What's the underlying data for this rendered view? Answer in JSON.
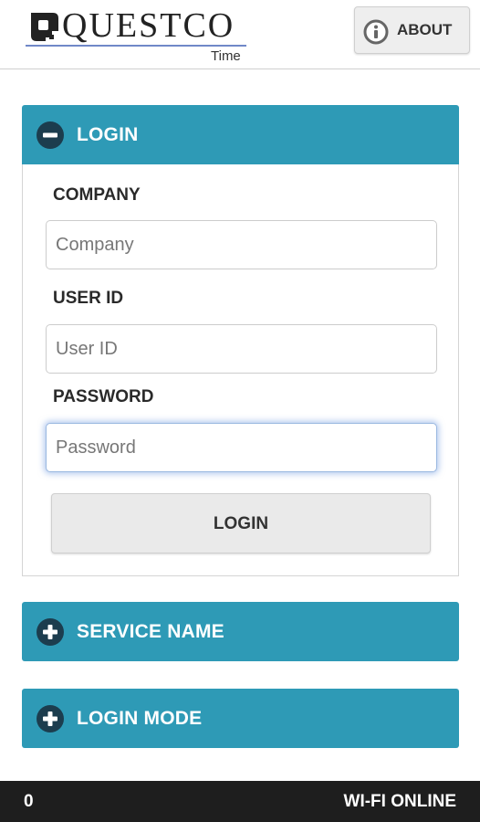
{
  "header": {
    "logo_text": "QUESTCO",
    "logo_subtitle": "Time",
    "about_label": "ABOUT",
    "about_icon": "info-icon"
  },
  "login_panel": {
    "title": "LOGIN",
    "icon": "minus-circle-icon",
    "company": {
      "label": "COMPANY",
      "placeholder": "Company",
      "value": ""
    },
    "user_id": {
      "label": "USER ID",
      "placeholder": "User ID",
      "value": ""
    },
    "password": {
      "label": "PASSWORD",
      "placeholder": "Password",
      "value": ""
    },
    "submit_label": "LOGIN"
  },
  "service_panel": {
    "title": "SERVICE NAME",
    "icon": "plus-circle-icon"
  },
  "mode_panel": {
    "title": "LOGIN MODE",
    "icon": "plus-circle-icon"
  },
  "footer": {
    "count": "0",
    "status": "WI-FI ONLINE"
  },
  "colors": {
    "accent": "#2e9ab6",
    "footer_bg": "#1e1e1e",
    "logo_underline": "#7088c8"
  }
}
